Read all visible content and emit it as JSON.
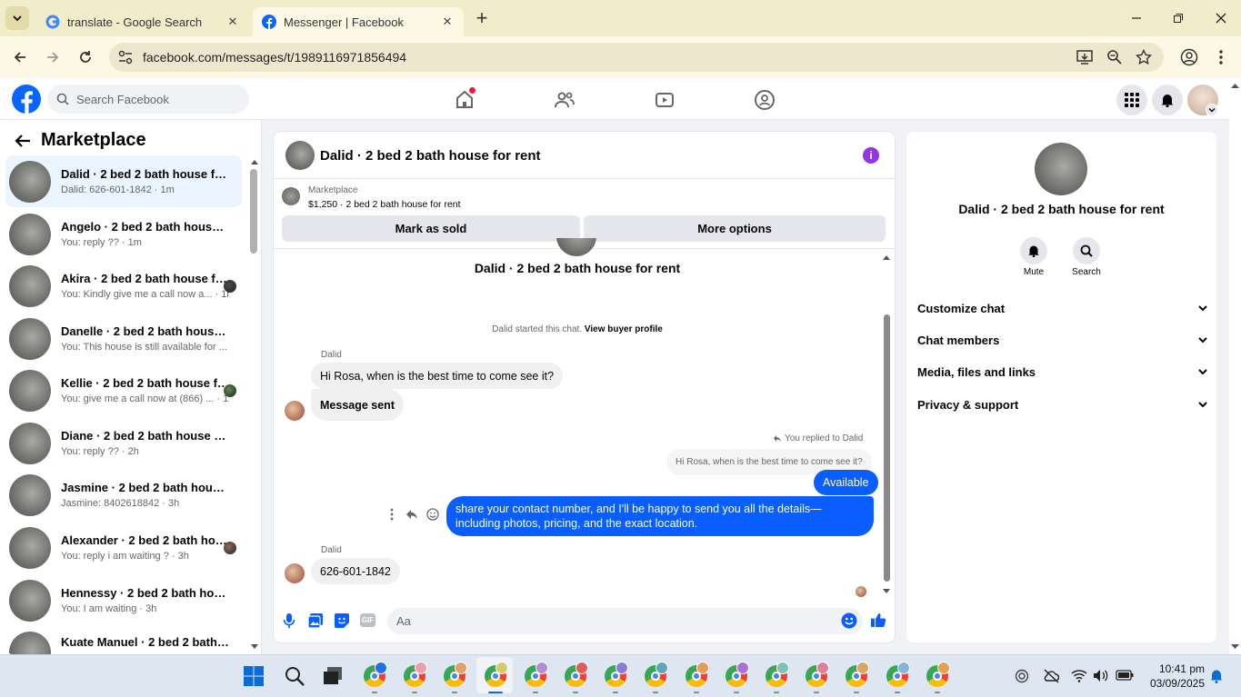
{
  "browser": {
    "tabs": [
      {
        "title": "translate - Google Search",
        "active": false
      },
      {
        "title": "Messenger | Facebook",
        "active": true
      }
    ],
    "url": "facebook.com/messages/t/1989116971856494"
  },
  "facebook": {
    "search_placeholder": "Search Facebook"
  },
  "sidebar": {
    "title": "Marketplace",
    "conversations": [
      {
        "name": "Dalid · 2 bed 2 bath house for r...",
        "preview": "Dalid: 626-601-1842 · 1m",
        "selected": true
      },
      {
        "name": "Angelo · 2 bed 2 bath house for...",
        "preview": "You: reply ?? · 1m"
      },
      {
        "name": "Akira · 2 bed 2 bath house fo...",
        "preview": "You: Kindly give me a call now a... · 1h"
      },
      {
        "name": "Danelle · 2 bed 2 bath house fo...",
        "preview": "You: This house is still available for ... · 1h"
      },
      {
        "name": "Kellie · 2 bed 2 bath house fo...",
        "preview": "You: give me a call now at (866) ... · 1h"
      },
      {
        "name": "Diane · 2 bed 2 bath house for r...",
        "preview": "You: reply ?? · 2h"
      },
      {
        "name": "Jasmine · 2 bed 2 bath house fo...",
        "preview": "Jasmine: 8402618842 · 3h"
      },
      {
        "name": "Alexander · 2 bed 2 bath hou...",
        "preview": "You: reply i am waiting ? · 3h"
      },
      {
        "name": "Hennessy · 2 bed 2 bath house f...",
        "preview": "You: I am waiting · 3h"
      },
      {
        "name": "Kuate Manuel · 2 bed 2 bath ...",
        "preview": ""
      }
    ]
  },
  "chat": {
    "title": "Dalid · 2 bed 2 bath house for rent",
    "listing_source": "Marketplace",
    "listing_desc": "$1,250 · 2 bed 2 bath house for rent",
    "mark_sold": "Mark as sold",
    "more_options": "More options",
    "profile_name": "Dalid · 2 bed 2 bath house for rent",
    "started_text": "Dalid started this chat.",
    "view_profile": "View buyer profile",
    "sender1": "Dalid",
    "msg1": "Hi Rosa, when is the best time to come see it?",
    "msg2": "Message sent",
    "replied_label": "You replied to Dalid",
    "quoted": "Hi Rosa, when is the best time to come see it?",
    "msg3": "Available",
    "msg4": "share your contact number, and I'll be happy to send you all the details—including photos, pricing, and the exact location.",
    "sender2": "Dalid",
    "msg5": "626-601-1842",
    "composer_placeholder": "Aa"
  },
  "info": {
    "name": "Dalid · 2 bed 2 bath house for rent",
    "mute": "Mute",
    "search": "Search",
    "sections": [
      "Customize chat",
      "Chat members",
      "Media, files and links",
      "Privacy & support"
    ]
  },
  "taskbar": {
    "time": "10:41 pm",
    "date": "03/09/2025"
  }
}
